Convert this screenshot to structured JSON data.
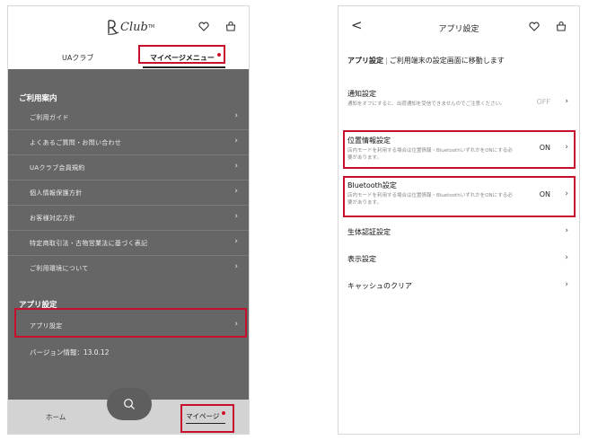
{
  "colors": {
    "highlight": "#c8102e",
    "menu_bg": "#666666",
    "bottom_bar": "#d3d3d3"
  },
  "left": {
    "logo": {
      "text": "Club",
      "tm": "TM"
    },
    "header_icons": [
      "heart-icon",
      "bag-icon"
    ],
    "tabs": {
      "club": "UAクラブ",
      "mypage_menu": "マイページメニュー"
    },
    "sections": [
      {
        "title": "ご利用案内",
        "items": [
          "ご利用ガイド",
          "よくあるご質問・お問い合わせ",
          "UAクラブ会員規約",
          "個人情報保護方針",
          "お客様対応方針",
          "特定商取引法・古物営業法に基づく表記",
          "ご利用環境について"
        ]
      },
      {
        "title": "アプリ設定",
        "items": [
          "アプリ設定"
        ]
      }
    ],
    "version": "バージョン情報：13.0.12",
    "bottom_nav": {
      "home": "ホーム",
      "mypage": "マイページ"
    }
  },
  "right": {
    "back": "<",
    "title": "アプリ設定",
    "desc_bold": "アプリ設定",
    "desc_sep": "|",
    "desc_text": "ご利用端末の設定画面に移動します",
    "rows": [
      {
        "title": "通知設定",
        "sub": "通知をオフにすると、出荷通知を受信できませんのでご注意ください。",
        "value": "OFF"
      },
      {
        "title": "位置情報設定",
        "sub": "店内モードを利用する場合は位置情報・BluetoothいずれかをONにする必要があります。",
        "value": "ON"
      },
      {
        "title": "Bluetooth設定",
        "sub": "店内モードを利用する場合は位置情報・BluetoothいずれかをONにする必要があります。",
        "value": "ON"
      },
      {
        "title": "生体認証設定",
        "sub": "",
        "value": ""
      },
      {
        "title": "表示設定",
        "sub": "",
        "value": ""
      },
      {
        "title": "キャッシュのクリア",
        "sub": "",
        "value": ""
      }
    ]
  }
}
